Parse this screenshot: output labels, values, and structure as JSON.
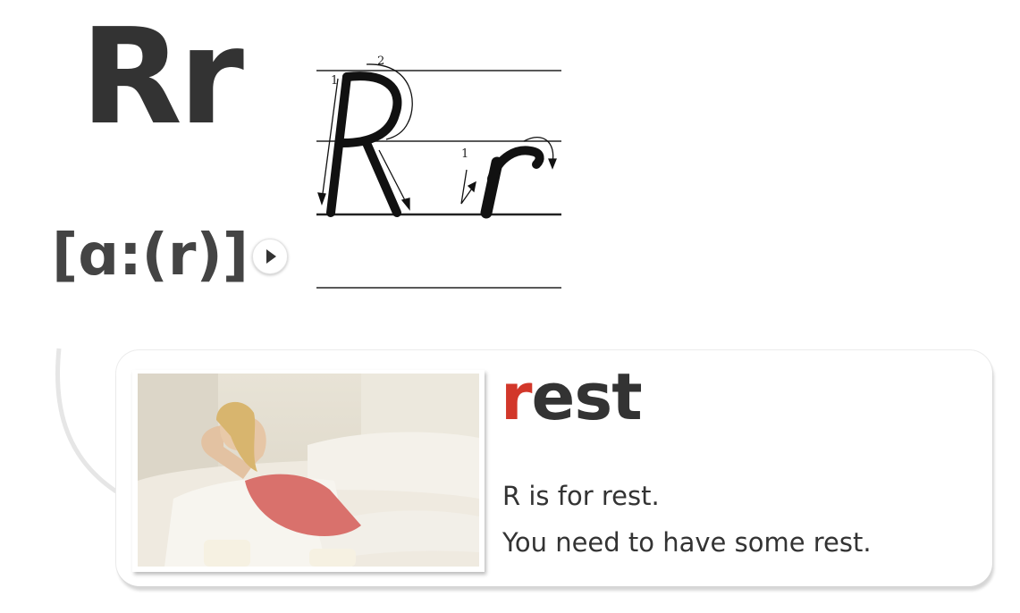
{
  "letter": {
    "display": "Rr"
  },
  "phonetic": {
    "text": "[ɑ:(r)]",
    "play_icon": "play-icon"
  },
  "stroke_guide": {
    "stroke_numbers": [
      "1",
      "2",
      "1"
    ],
    "letters": [
      "R",
      "r"
    ]
  },
  "vocab": {
    "word_first": "r",
    "word_rest": "est",
    "sentences": [
      "R is for rest.",
      "You need to have some rest."
    ],
    "accent_color": "#d2372a",
    "photo": "woman-resting-on-sofa"
  }
}
